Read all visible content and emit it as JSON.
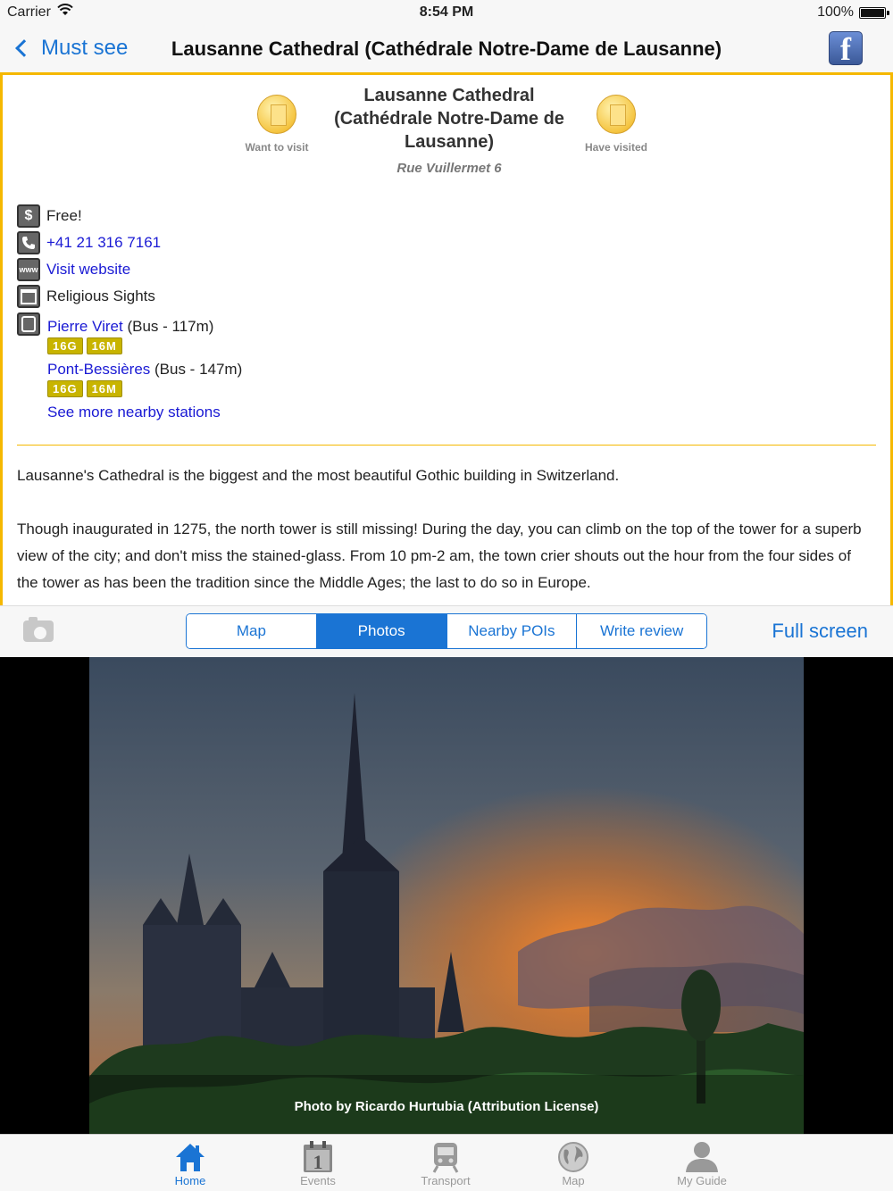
{
  "status": {
    "carrier": "Carrier",
    "time": "8:54 PM",
    "battery": "100%"
  },
  "nav": {
    "back_label": "Must see",
    "title": "Lausanne Cathedral (Cathédrale Notre-Dame de Lausanne)",
    "facebook": "f"
  },
  "place": {
    "title": "Lausanne Cathedral (Cathédrale Notre-Dame de Lausanne)",
    "address": "Rue Vuillermet 6",
    "want_label": "Want to visit",
    "have_label": "Have visited",
    "price": "Free!",
    "phone": "+41 21 316 7161",
    "website": "Visit website",
    "category": "Religious Sights",
    "stations": [
      {
        "name": "Pierre Viret",
        "detail": " (Bus - 117m)",
        "lines": [
          "16G",
          "16M"
        ]
      },
      {
        "name": "Pont-Bessières",
        "detail": " (Bus - 147m)",
        "lines": [
          "16G",
          "16M"
        ]
      }
    ],
    "more_stations": "See more nearby stations",
    "description": [
      "Lausanne's Cathedral is the biggest and the most beautiful Gothic building in Switzerland.",
      "Though inaugurated in 1275, the north tower is still missing! During the day, you can climb on the top of the tower for a superb view of the city; and don't miss the stained-glass. From 10 pm-2 am, the town crier shouts out the hour from the four sides of the tower as has been the tradition since the Middle Ages; the last to do so in Europe."
    ]
  },
  "segments": {
    "items": [
      "Map",
      "Photos",
      "Nearby POIs",
      "Write review"
    ],
    "selected": "Photos"
  },
  "toolbar": {
    "fullscreen": "Full screen"
  },
  "photo": {
    "caption": "Photo by Ricardo Hurtubia (Attribution License)"
  },
  "tabs": [
    {
      "label": "Home",
      "icon": "home-icon"
    },
    {
      "label": "Events",
      "icon": "calendar-icon"
    },
    {
      "label": "Transport",
      "icon": "train-icon"
    },
    {
      "label": "Map",
      "icon": "globe-icon"
    },
    {
      "label": "My Guide",
      "icon": "person-icon"
    }
  ],
  "colors": {
    "accent": "#1a74d4",
    "gold": "#f5b800",
    "line_badge": "#c8b400",
    "link": "#1a1ad4"
  }
}
